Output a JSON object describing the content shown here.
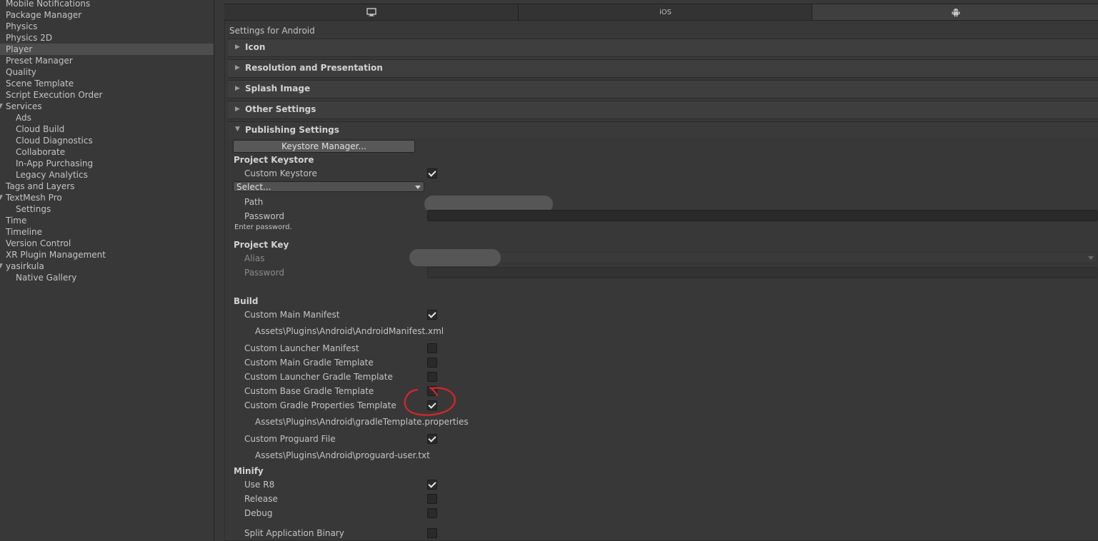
{
  "sidebar": {
    "items": [
      {
        "label": "Mobile Notifications",
        "indent": 0
      },
      {
        "label": "Package Manager",
        "indent": 0
      },
      {
        "label": "Physics",
        "indent": 0
      },
      {
        "label": "Physics 2D",
        "indent": 0
      },
      {
        "label": "Player",
        "indent": 0,
        "selected": true
      },
      {
        "label": "Preset Manager",
        "indent": 0
      },
      {
        "label": "Quality",
        "indent": 0
      },
      {
        "label": "Scene Template",
        "indent": 0
      },
      {
        "label": "Script Execution Order",
        "indent": 0
      },
      {
        "label": "Services",
        "indent": 0,
        "expanded": true
      },
      {
        "label": "Ads",
        "indent": 1
      },
      {
        "label": "Cloud Build",
        "indent": 1
      },
      {
        "label": "Cloud Diagnostics",
        "indent": 1
      },
      {
        "label": "Collaborate",
        "indent": 1
      },
      {
        "label": "In-App Purchasing",
        "indent": 1
      },
      {
        "label": "Legacy Analytics",
        "indent": 1
      },
      {
        "label": "Tags and Layers",
        "indent": 0
      },
      {
        "label": "TextMesh Pro",
        "indent": 0,
        "expanded": true
      },
      {
        "label": "Settings",
        "indent": 1
      },
      {
        "label": "Time",
        "indent": 0
      },
      {
        "label": "Timeline",
        "indent": 0
      },
      {
        "label": "Version Control",
        "indent": 0
      },
      {
        "label": "XR Plugin Management",
        "indent": 0
      },
      {
        "label": "yasirkula",
        "indent": 0,
        "expanded": true
      },
      {
        "label": "Native Gallery",
        "indent": 1
      }
    ]
  },
  "platform_tabs": {
    "standalone_icon": "monitor-icon",
    "ios_label": "iOS",
    "android_icon": "android-icon",
    "active": "android"
  },
  "settings_for": "Settings for Android",
  "foldouts": {
    "icon": "Icon",
    "resolution": "Resolution and Presentation",
    "splash": "Splash Image",
    "other": "Other Settings",
    "publishing": "Publishing Settings"
  },
  "publishing": {
    "keystore_manager_button": "Keystore Manager...",
    "project_keystore_header": "Project Keystore",
    "custom_keystore_label": "Custom Keystore",
    "custom_keystore_checked": true,
    "keystore_select_value": "Select...",
    "path_label": "Path",
    "password_label": "Password",
    "enter_password_hint": "Enter password.",
    "project_key_header": "Project Key",
    "alias_label": "Alias",
    "key_password_label": "Password"
  },
  "build": {
    "header": "Build",
    "custom_main_manifest": {
      "label": "Custom Main Manifest",
      "checked": true,
      "path": "Assets\\Plugins\\Android\\AndroidManifest.xml"
    },
    "custom_launcher_manifest": {
      "label": "Custom Launcher Manifest",
      "checked": false
    },
    "custom_main_gradle": {
      "label": "Custom Main Gradle Template",
      "checked": false
    },
    "custom_launcher_gradle": {
      "label": "Custom Launcher Gradle Template",
      "checked": false
    },
    "custom_base_gradle": {
      "label": "Custom Base Gradle Template",
      "checked": false
    },
    "custom_gradle_properties": {
      "label": "Custom Gradle Properties Template",
      "checked": true,
      "path": "Assets\\Plugins\\Android\\gradleTemplate.properties"
    },
    "custom_proguard": {
      "label": "Custom Proguard File",
      "checked": true,
      "path": "Assets\\Plugins\\Android\\proguard-user.txt"
    }
  },
  "minify": {
    "header": "Minify",
    "use_r8": {
      "label": "Use R8",
      "checked": true
    },
    "release": {
      "label": "Release",
      "checked": false
    },
    "debug": {
      "label": "Debug",
      "checked": false
    }
  },
  "split_binary": {
    "label": "Split Application Binary",
    "checked": false
  },
  "colors": {
    "background": "#383838",
    "selected_row": "#4d4d4d",
    "annotation": "#d9262a"
  }
}
